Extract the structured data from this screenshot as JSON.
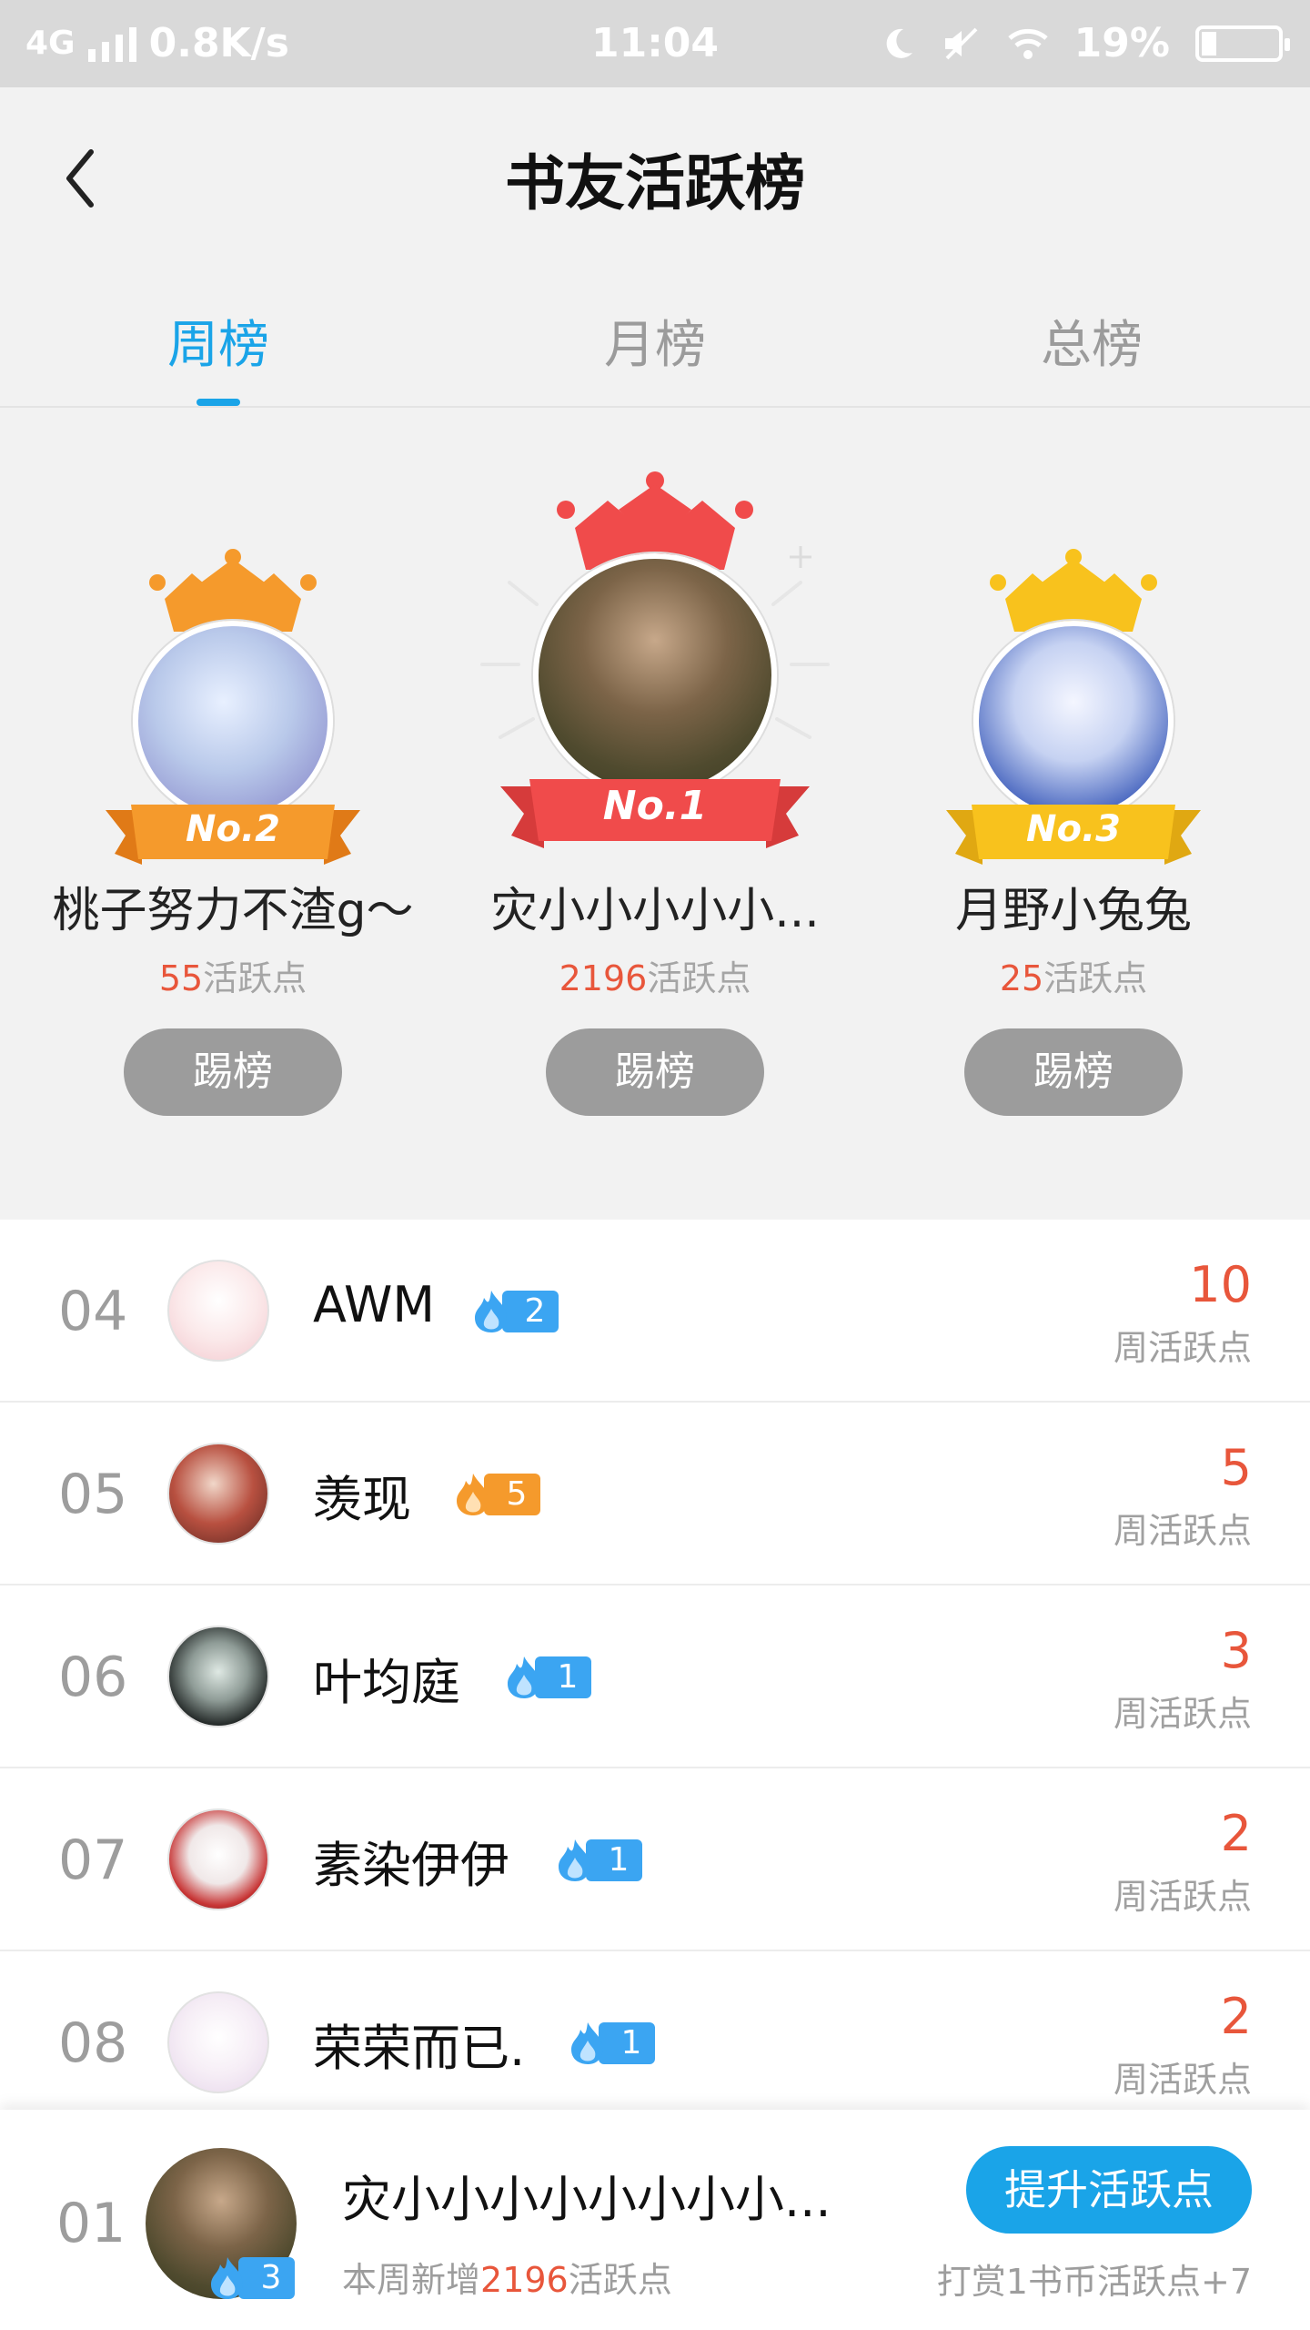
{
  "status_bar": {
    "network": "4G",
    "speed": "0.8K/s",
    "time": "11:04",
    "battery": "19%",
    "battery_level": 0.19,
    "icons": [
      "signal-icon",
      "moon-icon",
      "mute-icon",
      "wifi-icon",
      "battery-icon"
    ]
  },
  "header": {
    "title": "书友活跃榜",
    "back_icon": "chevron-left-icon"
  },
  "tabs": [
    {
      "label": "周榜",
      "active": true
    },
    {
      "label": "月榜",
      "active": false
    },
    {
      "label": "总榜",
      "active": false
    }
  ],
  "podium": {
    "first": {
      "rank_label": "No.1",
      "name": "灾小小小小小...",
      "points": "2196",
      "points_suffix": "活跃点",
      "button": "踢榜",
      "crown_color": "#f04b4b",
      "ribbon_color": "#f04b4b"
    },
    "second": {
      "rank_label": "No.2",
      "name": "桃子努力不渣g～",
      "points": "55",
      "points_suffix": "活跃点",
      "button": "踢榜",
      "crown_color": "#f59a2c",
      "ribbon_color": "#f59a2c"
    },
    "third": {
      "rank_label": "No.3",
      "name": "月野小兔兔",
      "points": "25",
      "points_suffix": "活跃点",
      "button": "踢榜",
      "crown_color": "#f8c21d",
      "ribbon_color": "#f8c21d"
    }
  },
  "list": [
    {
      "rank": "04",
      "name": "AWM",
      "level": "2",
      "badge": "blue",
      "score": "10",
      "score_label": "周活跃点"
    },
    {
      "rank": "05",
      "name": "羡现",
      "level": "5",
      "badge": "orange",
      "score": "5",
      "score_label": "周活跃点"
    },
    {
      "rank": "06",
      "name": "叶均庭",
      "level": "1",
      "badge": "blue",
      "score": "3",
      "score_label": "周活跃点"
    },
    {
      "rank": "07",
      "name": "素染伊伊",
      "level": "1",
      "badge": "blue",
      "score": "2",
      "score_label": "周活跃点"
    },
    {
      "rank": "08",
      "name": "荣荣而已.",
      "level": "1",
      "badge": "blue",
      "score": "2",
      "score_label": "周活跃点"
    }
  ],
  "my_rank": {
    "rank": "01",
    "name": "灾小小小小小小小小...",
    "level": "3",
    "sub_prefix": "本周新增",
    "sub_points": "2196",
    "sub_suffix": "活跃点",
    "button": "提升活跃点",
    "tip": "打赏1书币活跃点+7"
  },
  "colors": {
    "accent": "#1aa4e8",
    "score": "#e8563b",
    "button_gray": "#9c9c9c"
  }
}
